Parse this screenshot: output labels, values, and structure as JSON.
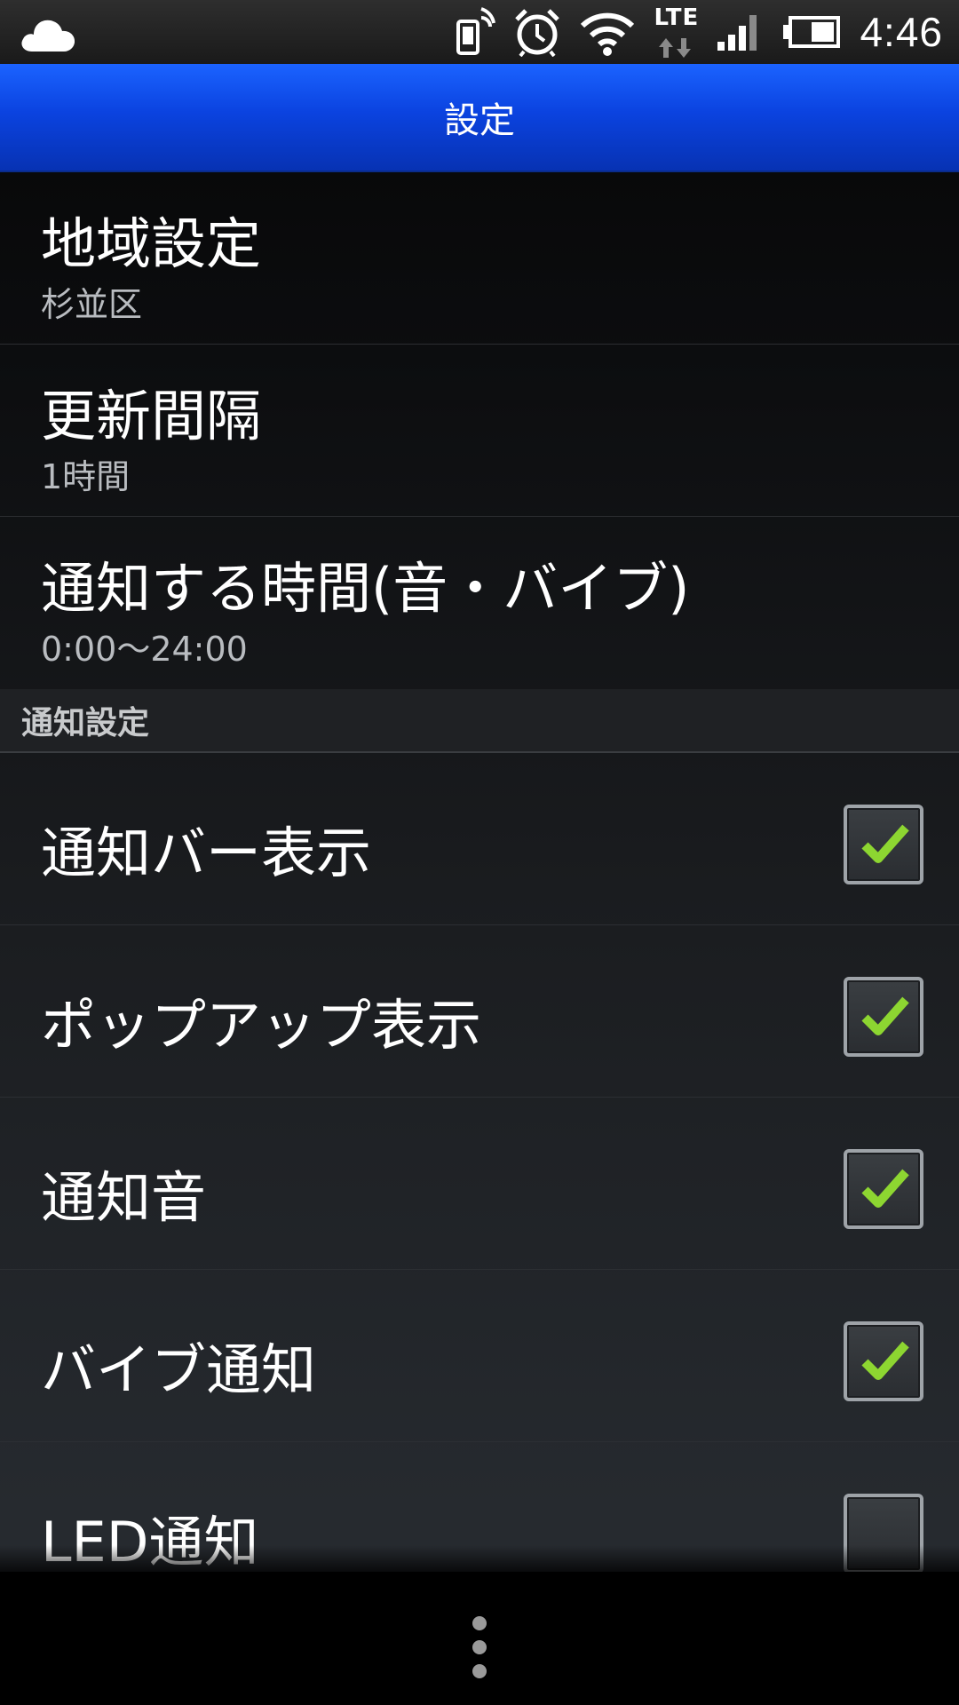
{
  "status_bar": {
    "time": "4:46",
    "network_type": "LTE",
    "icons": [
      "cloud-icon",
      "phone-signal-icon",
      "alarm-icon",
      "wifi-icon",
      "lte-icon",
      "cell-signal-icon",
      "battery-icon"
    ]
  },
  "action_bar": {
    "title": "設定"
  },
  "preferences": [
    {
      "title": "地域設定",
      "summary": "杉並区"
    },
    {
      "title": "更新間隔",
      "summary": "1時間"
    },
    {
      "title": "通知する時間(音・バイブ)",
      "summary": "0:00〜24:00"
    }
  ],
  "notification_category": {
    "title": "通知設定",
    "items": [
      {
        "label": "通知バー表示",
        "checked": true
      },
      {
        "label": "ポップアップ表示",
        "checked": true
      },
      {
        "label": "通知音",
        "checked": true
      },
      {
        "label": "バイブ通知",
        "checked": true
      },
      {
        "label": "LED通知",
        "checked": false
      }
    ]
  },
  "colors": {
    "action_bar": "#0b43e0",
    "checkmark": "#8dd631"
  },
  "nav_bar": {
    "icon": "overflow-menu-icon"
  }
}
